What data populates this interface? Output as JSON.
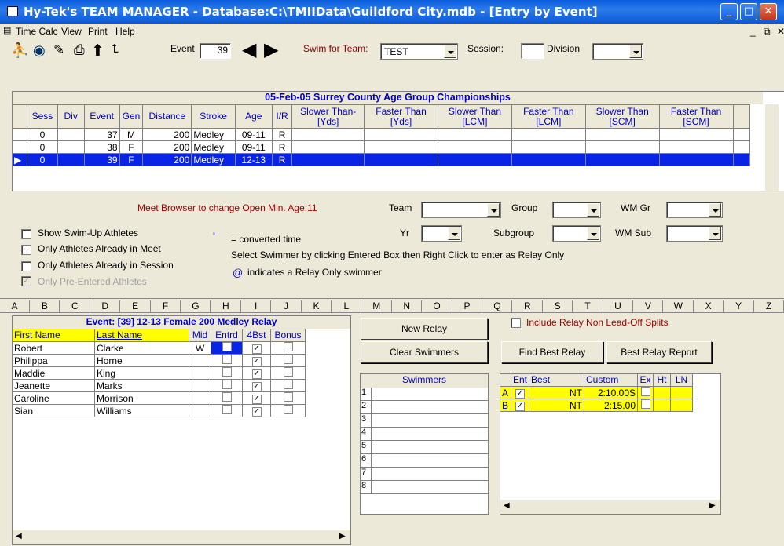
{
  "window": {
    "title": "Hy-Tek's TEAM MANAGER - Database:C:\\TMIIData\\Guildford City.mdb - [Entry by Event]"
  },
  "menu": [
    "Time Calc",
    "View",
    "Print",
    "Help"
  ],
  "toolbar": {
    "event_label": "Event",
    "event_value": "39",
    "swim_for_team_label": "Swim for Team:",
    "team_value": "TEST",
    "session_label": "Session:",
    "session_value": "",
    "division_label": "Division",
    "division_value": ""
  },
  "events": {
    "title": "05-Feb-05  Surrey County Age Group Championships",
    "headers": [
      "Sess",
      "Div",
      "Event",
      "Gen",
      "Distance",
      "Stroke",
      "Age",
      "I/R",
      "Slower Than-[Yds]",
      "Faster Than [Yds]",
      "Slower Than [LCM]",
      "Faster Than [LCM]",
      "Slower Than [SCM]",
      "Faster Than [SCM]"
    ],
    "rows": [
      [
        "0",
        "",
        "37",
        "M",
        "200",
        "Medley",
        "09-11",
        "R"
      ],
      [
        "0",
        "",
        "38",
        "F",
        "200",
        "Medley",
        "09-11",
        "R"
      ],
      [
        "0",
        "",
        "39",
        "F",
        "200",
        "Medley",
        "12-13",
        "R"
      ]
    ]
  },
  "options": {
    "meet_browser_note": "Meet Browser to change Open Min. Age:11",
    "team_label": "Team",
    "group_label": "Group",
    "wm_gr_label": "WM Gr",
    "yr_label": "Yr",
    "subgroup_label": "Subgroup",
    "wm_sub_label": "WM Sub",
    "show_swim_up": "Show Swim-Up Athletes",
    "only_in_meet": "Only Athletes Already in Meet",
    "only_in_session": "Only Athletes Already in Session",
    "only_pre_entered": "Only Pre-Entered Athletes",
    "converted_mark": "'",
    "converted_note": "= converted time",
    "select_note": "Select Swimmer by clicking Entered Box then Right Click to enter as Relay Only",
    "at_mark": "@",
    "relay_only_note": "indicates a Relay Only swimmer"
  },
  "alphabet": [
    "A",
    "B",
    "C",
    "D",
    "E",
    "F",
    "G",
    "H",
    "I",
    "J",
    "K",
    "L",
    "M",
    "N",
    "O",
    "P",
    "Q",
    "R",
    "S",
    "T",
    "U",
    "V",
    "W",
    "X",
    "Y",
    "Z"
  ],
  "athletes": {
    "title": "Event: [39]  12-13  Female   200  Medley Relay",
    "headers": [
      "First Name",
      "Last Name",
      "Mid",
      "Entrd",
      "4Bst",
      "Bonus"
    ],
    "rows": [
      {
        "first": "Robert",
        "last": "Clarke",
        "mid": "W",
        "entrd": false,
        "best": true,
        "bonus": false
      },
      {
        "first": "Philippa",
        "last": "Horne",
        "mid": "",
        "entrd": false,
        "best": true,
        "bonus": false
      },
      {
        "first": "Maddie",
        "last": "King",
        "mid": "",
        "entrd": false,
        "best": true,
        "bonus": false
      },
      {
        "first": "Jeanette",
        "last": "Marks",
        "mid": "",
        "entrd": false,
        "best": true,
        "bonus": false
      },
      {
        "first": "Caroline",
        "last": "Morrison",
        "mid": "",
        "entrd": false,
        "best": true,
        "bonus": false
      },
      {
        "first": "Sian",
        "last": "Williams",
        "mid": "",
        "entrd": false,
        "best": true,
        "bonus": false
      }
    ]
  },
  "relay": {
    "new_relay": "New Relay",
    "clear_swimmers": "Clear Swimmers",
    "include_splits": "Include Relay Non Lead-Off Splits",
    "find_best": "Find Best Relay",
    "best_report": "Best Relay Report",
    "swimmers_header": "Swimmers",
    "swimmer_slots": [
      "1",
      "2",
      "3",
      "4",
      "5",
      "6",
      "7",
      "8"
    ],
    "teams_headers": [
      "Ent",
      "Best",
      "Custom",
      "Ex",
      "Ht",
      "LN"
    ],
    "teams": [
      {
        "id": "A",
        "ent": true,
        "best": "NT",
        "custom": "2:10.00S",
        "ex": false
      },
      {
        "id": "B",
        "ent": true,
        "best": "NT",
        "custom": "2:15.00",
        "ex": false
      }
    ]
  }
}
